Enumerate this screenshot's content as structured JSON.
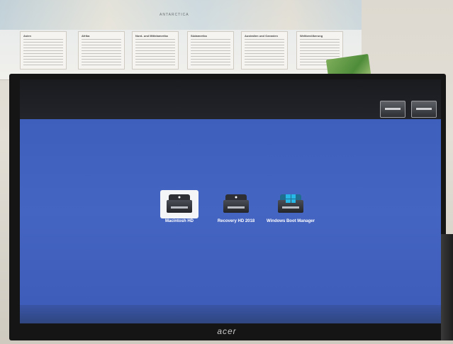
{
  "poster": {
    "map_label": "ANTARCTICA",
    "legends": [
      {
        "title": "Asien"
      },
      {
        "title": "Afrika"
      },
      {
        "title": "Nord- und Mittelamerika"
      },
      {
        "title": "Südamerika"
      },
      {
        "title": "Australien und Ozeanien"
      },
      {
        "title": "Weltbevölkerung"
      }
    ]
  },
  "monitor": {
    "brand": "acer",
    "boot_volumes": [
      {
        "label": "Macintosh HD",
        "icon": "apple-disk-icon",
        "selected": true
      },
      {
        "label": "Recovery HD 2018",
        "icon": "apple-disk-icon",
        "selected": false
      },
      {
        "label": "Windows Boot Manager",
        "icon": "windows-disk-icon",
        "selected": false
      }
    ],
    "tray_icons": [
      {
        "icon": "startup-disk-icon"
      },
      {
        "icon": "network-icon"
      }
    ]
  },
  "colors": {
    "desktop": "#4262c0",
    "selection_frame": "#f4f5f7",
    "windows_accent": "#27b8e8"
  }
}
